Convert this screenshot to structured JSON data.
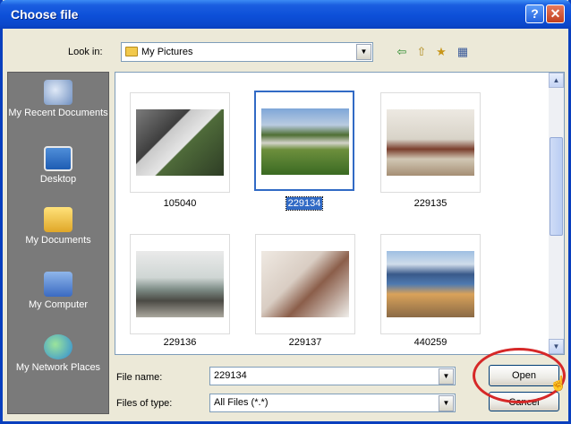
{
  "window": {
    "title": "Choose file"
  },
  "lookin": {
    "label": "Look in:",
    "value": "My Pictures"
  },
  "places": [
    {
      "id": "recent",
      "label": "My Recent Documents"
    },
    {
      "id": "desktop",
      "label": "Desktop"
    },
    {
      "id": "documents",
      "label": "My Documents"
    },
    {
      "id": "computer",
      "label": "My Computer"
    },
    {
      "id": "network",
      "label": "My Network Places"
    }
  ],
  "files": [
    {
      "name": "105040",
      "selected": false
    },
    {
      "name": "229134",
      "selected": true
    },
    {
      "name": "229135",
      "selected": false
    },
    {
      "name": "229136",
      "selected": false
    },
    {
      "name": "229137",
      "selected": false
    },
    {
      "name": "440259",
      "selected": false
    }
  ],
  "filename": {
    "label": "File name:",
    "value": "229134"
  },
  "filetype": {
    "label": "Files of type:",
    "value": "All Files (*.*)"
  },
  "buttons": {
    "open": "Open",
    "cancel": "Cancel"
  },
  "icons": {
    "help": "?",
    "close": "✕",
    "dropdown": "▼",
    "back": "⇦",
    "up": "⇧",
    "newfolder": "★",
    "views": "▦",
    "scroll_up": "▲",
    "scroll_down": "▼",
    "cursor": "☝"
  },
  "colors": {
    "titlebar": "#0b48cc",
    "selection": "#316ac5",
    "annotation": "#d62828"
  }
}
